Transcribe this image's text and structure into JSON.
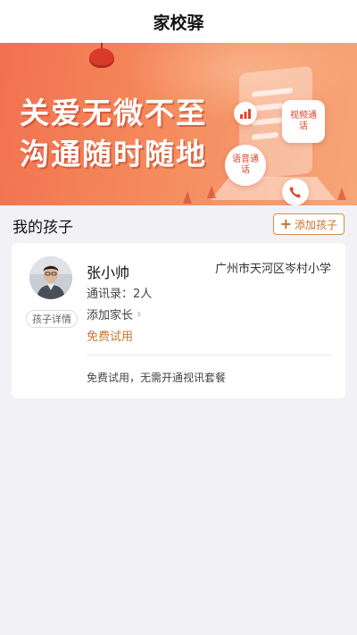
{
  "header": {
    "title": "家校驿"
  },
  "banner": {
    "slogan_line1": "关爱无微不至",
    "slogan_line2": "沟通随时随地",
    "video_call_label": "视频通话",
    "voice_call_label": "语音通话",
    "accent_color": "#f2714f"
  },
  "children_section": {
    "title": "我的孩子",
    "add_button_label": "添加孩子"
  },
  "child_card": {
    "name": "张小帅",
    "school": "广州市天河区岑村小学",
    "contacts": "通讯录：2人",
    "add_parent_label": "添加家长",
    "trial_label": "免费试用",
    "detail_button_label": "孩子详情",
    "trial_note": "免费试用，无需开通视讯套餐",
    "trial_color": "#c9782f"
  }
}
